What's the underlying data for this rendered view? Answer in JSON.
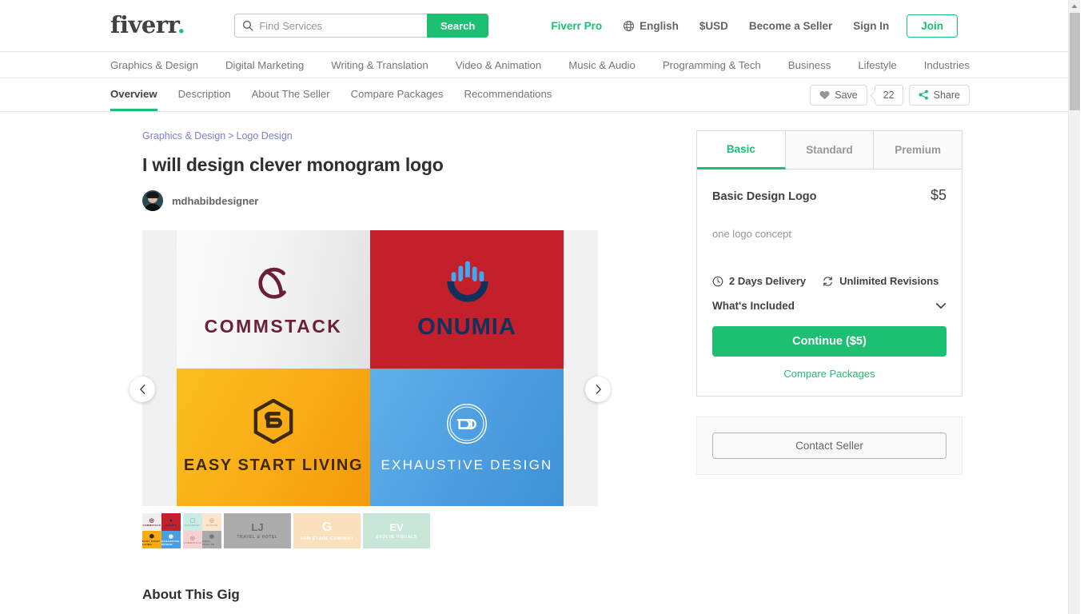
{
  "header": {
    "logo": "fiverr",
    "logo_dot": ".",
    "search": {
      "placeholder": "Find Services",
      "value": "",
      "button_label": "Search",
      "icon": "search-icon"
    },
    "pro_label": "Fiverr Pro",
    "language": "English",
    "language_icon": "globe-icon",
    "currency": "$USD",
    "become_seller": "Become a Seller",
    "sign_in": "Sign In",
    "join": "Join"
  },
  "categories": [
    "Graphics & Design",
    "Digital Marketing",
    "Writing & Translation",
    "Video & Animation",
    "Music & Audio",
    "Programming & Tech",
    "Business",
    "Lifestyle",
    "Industries"
  ],
  "tabs": [
    {
      "label": "Overview",
      "active": true
    },
    {
      "label": "Description",
      "active": false
    },
    {
      "label": "About The Seller",
      "active": false
    },
    {
      "label": "Compare Packages",
      "active": false
    },
    {
      "label": "Recommendations",
      "active": false
    }
  ],
  "tab_actions": {
    "save_label": "Save",
    "save_icon": "heart-icon",
    "save_count": "22",
    "share_label": "Share",
    "share_icon": "share-icon"
  },
  "gig": {
    "breadcrumb": [
      "Graphics & Design",
      "Logo Design"
    ],
    "breadcrumb_separator": ">",
    "title": "I will design clever monogram logo",
    "seller_name": "mdhabibdesigner",
    "avatar_icon": "seller-avatar",
    "about_heading": "About This Gig"
  },
  "gallery": {
    "prev_icon": "chevron-left-icon",
    "next_icon": "chevron-right-icon",
    "collage": [
      {
        "name": "COMMSTACK",
        "monogram": "CS",
        "bg": "#f4f4f4",
        "fg": "#6b2039"
      },
      {
        "name": "ONUMIA",
        "monogram": "U",
        "bg": "#c3202c",
        "fg": "#10305e"
      },
      {
        "name": "EASY START LIVING",
        "monogram": "ES",
        "bg": "#f9ab16",
        "fg": "#3c2a10"
      },
      {
        "name": "EXHAUSTIVE DESIGN",
        "monogram": "ED",
        "bg": "#4c9ee0",
        "fg": "#ffffff"
      }
    ],
    "thumbnails": [
      {
        "type": "grid",
        "cells": [
          {
            "name": "COMMSTACK",
            "bg": "#f0f0f0",
            "fg": "#6b2039"
          },
          {
            "name": "ONUMIA",
            "bg": "#c3202c",
            "fg": "#10305e"
          },
          {
            "name": "EASY START LIVING",
            "bg": "#f9ab16",
            "fg": "#3c2a10"
          },
          {
            "name": "EXHAUSTIVE DESIGN",
            "bg": "#4c9ee0",
            "fg": "#ffffff"
          }
        ]
      },
      {
        "type": "grid",
        "cells": [
          {
            "name": "INTERIORS",
            "bg": "#c9ece6",
            "fg": "#8fbdb6"
          },
          {
            "name": "RICCAM",
            "bg": "#fae6cd",
            "fg": "#cfa97f"
          },
          {
            "name": "COMMSTACK",
            "bg": "#f6d1d1",
            "fg": "#c98a8a"
          },
          {
            "name": "OPEN TRAILER",
            "bg": "#a9a9a9",
            "fg": "#6f6f6f"
          }
        ]
      },
      {
        "type": "solid",
        "name": "TRAVEL & HOTEL",
        "bg": "#acacac",
        "fg": "#6d6d6d",
        "monogram": "LJ"
      },
      {
        "type": "solid",
        "name": "GEM SHARE COMPANY",
        "bg": "#fae0bd",
        "fg": "#ffffff",
        "monogram": "G"
      },
      {
        "type": "solid",
        "name": "EVOLVE VISUALS",
        "bg": "#c8e7d8",
        "fg": "#ffffff",
        "monogram": "EV"
      }
    ]
  },
  "pricing": {
    "packages": [
      {
        "label": "Basic",
        "active": true
      },
      {
        "label": "Standard",
        "active": false
      },
      {
        "label": "Premium",
        "active": false
      }
    ],
    "package_name": "Basic Design Logo",
    "price": "$5",
    "description": "one logo concept",
    "delivery": "2 Days Delivery",
    "delivery_icon": "clock-icon",
    "revisions": "Unlimited Revisions",
    "revisions_icon": "refresh-icon",
    "whats_included": "What's Included",
    "whats_included_icon": "chevron-down-icon",
    "continue_label": "Continue ($5)",
    "compare_link": "Compare Packages",
    "contact_seller": "Contact Seller"
  },
  "colors": {
    "brand_green": "#1dbf73",
    "text_dark": "#404145",
    "text_muted": "#74767e",
    "link_purple": "#7a7fd6"
  }
}
